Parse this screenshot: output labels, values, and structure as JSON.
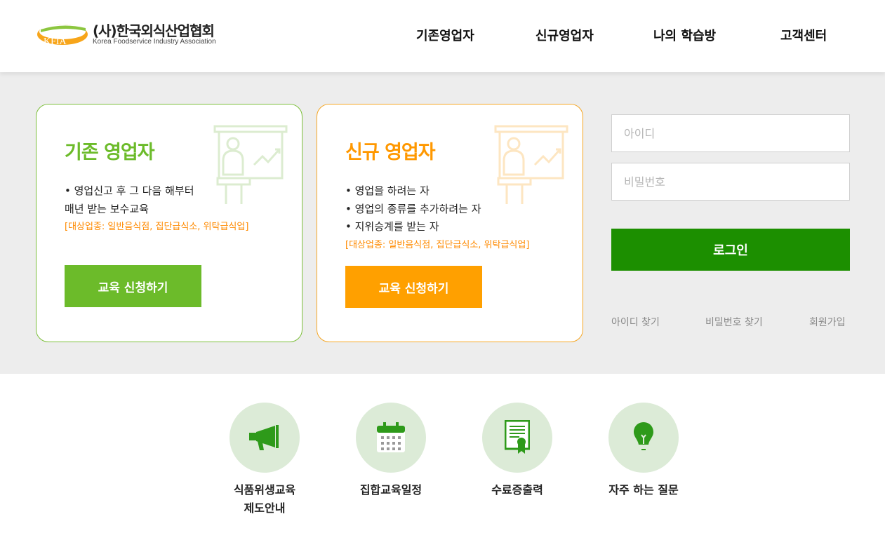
{
  "header": {
    "logo": {
      "name_ko": "(사)한국외식산업협회",
      "name_en": "Korea Foodservice Industry Association",
      "mark_text": "KFIA"
    },
    "nav": [
      "기존영업자",
      "신규영업자",
      "나의 학습방",
      "고객센터"
    ]
  },
  "cards": {
    "existing": {
      "title": "기존 영업자",
      "lines": [
        "• 영업신고 후 그 다음 해부터",
        "매년 받는 보수교육"
      ],
      "target": "[대상업종: 일반음식점, 집단급식소, 위탁급식업]",
      "button": "교육 신청하기",
      "accent": "#6cbb2a",
      "illustration_icon": "lecture-presenter-icon"
    },
    "new": {
      "title": "신규 영업자",
      "lines": [
        "• 영업을 하려는 자",
        "• 영업의 종류를 추가하려는 자",
        "• 지위승계를 받는 자"
      ],
      "target": "[대상업종: 일반음식점, 집단급식소, 위탁급식업]",
      "button": "교육 신청하기",
      "accent": "#ffa000",
      "illustration_icon": "lecture-presenter-icon"
    }
  },
  "login": {
    "id_placeholder": "아이디",
    "pw_placeholder": "비밀번호",
    "button": "로그인",
    "links": [
      "아이디 찾기",
      "비밀번호 찾기",
      "회원가입"
    ],
    "accent": "#1c8f00"
  },
  "quick_menu": [
    {
      "label": "식품위생교육\n제도안내",
      "icon": "megaphone-icon"
    },
    {
      "label": "집합교육일정",
      "icon": "calendar-icon"
    },
    {
      "label": "수료증출력",
      "icon": "certificate-icon"
    },
    {
      "label": "자주 하는 질문",
      "icon": "lightbulb-icon"
    }
  ]
}
